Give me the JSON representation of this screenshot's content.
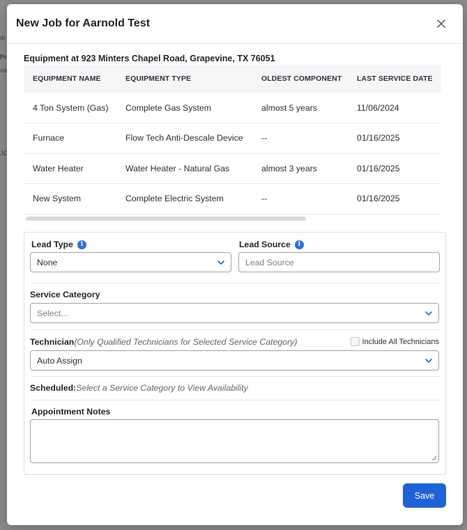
{
  "modal": {
    "title": "New Job for Aarnold Test",
    "equipment_heading": "Equipment at 923 Minters Chapel Road, Grapevine, TX 76051"
  },
  "equipment_table": {
    "headers": [
      "EQUIPMENT NAME",
      "EQUIPMENT TYPE",
      "OLDEST COMPONENT",
      "LAST SERVICE DATE"
    ],
    "rows": [
      [
        "4 Ton System (Gas)",
        "Complete Gas System",
        "almost 5 years",
        "11/06/2024"
      ],
      [
        "Furnace",
        "Flow Tech Anti-Descale Device",
        "--",
        "01/16/2025"
      ],
      [
        "Water Heater",
        "Water Heater - Natural Gas",
        "almost 3 years",
        "01/16/2025"
      ],
      [
        "New System",
        "Complete Electric System",
        "--",
        "01/16/2025"
      ]
    ]
  },
  "form": {
    "lead_type_label": "Lead Type",
    "lead_type_value": "None",
    "lead_source_label": "Lead Source",
    "lead_source_placeholder": "Lead Source",
    "service_category_label": "Service Category",
    "service_category_placeholder": "Select...",
    "technician_label": "Technician",
    "technician_hint": "(Only Qualified Technicians for Selected Service Category)",
    "include_all_label": "Include All Technicians",
    "technician_value": "Auto Assign",
    "scheduled_label": "Scheduled:",
    "scheduled_hint": "Select a Service Category to View Availability",
    "notes_label": "Appointment Notes",
    "save_label": "Save"
  },
  "background": {
    "fragments": [
      "Pr",
      "oa",
      "JC"
    ]
  },
  "colors": {
    "accent": "#1e63d6",
    "info_icon": "#2f6fdf",
    "overlay": "#8c8c8c"
  },
  "icons": {
    "close": "close-icon",
    "info": "info-icon",
    "chevron": "chevron-down-icon"
  }
}
